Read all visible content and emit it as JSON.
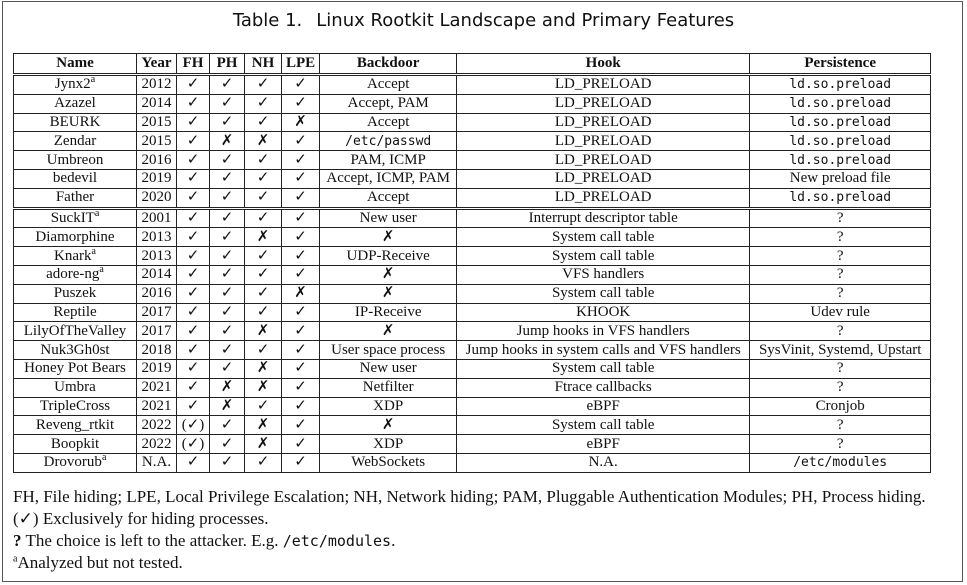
{
  "caption": {
    "number": "Table 1.",
    "title": "Linux Rootkit Landscape and Primary Features"
  },
  "headers": [
    "Name",
    "Year",
    "FH",
    "PH",
    "NH",
    "LPE",
    "Backdoor",
    "Hook",
    "Persistence"
  ],
  "group1": [
    {
      "name": "Jynx2",
      "sup": "a",
      "year": "2012",
      "fh": "✓",
      "ph": "✓",
      "nh": "✓",
      "lpe": "✓",
      "backdoor": "Accept",
      "hook": "LD_PRELOAD",
      "persistence": "ld.so.preload",
      "pmono": true
    },
    {
      "name": "Azazel",
      "sup": "",
      "year": "2014",
      "fh": "✓",
      "ph": "✓",
      "nh": "✓",
      "lpe": "✓",
      "backdoor": "Accept, PAM",
      "hook": "LD_PRELOAD",
      "persistence": "ld.so.preload",
      "pmono": true
    },
    {
      "name": "BEURK",
      "sup": "",
      "year": "2015",
      "fh": "✓",
      "ph": "✓",
      "nh": "✓",
      "lpe": "✗",
      "backdoor": "Accept",
      "hook": "LD_PRELOAD",
      "persistence": "ld.so.preload",
      "pmono": true
    },
    {
      "name": "Zendar",
      "sup": "",
      "year": "2015",
      "fh": "✓",
      "ph": "✗",
      "nh": "✗",
      "lpe": "✓",
      "backdoor": "/etc/passwd",
      "bmono": true,
      "hook": "LD_PRELOAD",
      "persistence": "ld.so.preload",
      "pmono": true
    },
    {
      "name": "Umbreon",
      "sup": "",
      "year": "2016",
      "fh": "✓",
      "ph": "✓",
      "nh": "✓",
      "lpe": "✓",
      "backdoor": "PAM, ICMP",
      "hook": "LD_PRELOAD",
      "persistence": "ld.so.preload",
      "pmono": true
    },
    {
      "name": "bedevil",
      "sup": "",
      "year": "2019",
      "fh": "✓",
      "ph": "✓",
      "nh": "✓",
      "lpe": "✓",
      "backdoor": "Accept, ICMP, PAM",
      "hook": "LD_PRELOAD",
      "persistence": "New preload file"
    },
    {
      "name": "Father",
      "sup": "",
      "year": "2020",
      "fh": "✓",
      "ph": "✓",
      "nh": "✓",
      "lpe": "✓",
      "backdoor": "Accept",
      "hook": "LD_PRELOAD",
      "persistence": "ld.so.preload",
      "pmono": true
    }
  ],
  "group2": [
    {
      "name": "SuckIT",
      "sup": "a",
      "year": "2001",
      "fh": "✓",
      "ph": "✓",
      "nh": "✓",
      "lpe": "✓",
      "backdoor": "New user",
      "hook": "Interrupt descriptor table",
      "persistence": "?"
    },
    {
      "name": "Diamorphine",
      "sup": "",
      "year": "2013",
      "fh": "✓",
      "ph": "✓",
      "nh": "✗",
      "lpe": "✓",
      "backdoor": "✗",
      "hook": "System call table",
      "persistence": "?"
    },
    {
      "name": "Knark",
      "sup": "a",
      "year": "2013",
      "fh": "✓",
      "ph": "✓",
      "nh": "✓",
      "lpe": "✓",
      "backdoor": "UDP-Receive",
      "hook": "System call table",
      "persistence": "?"
    },
    {
      "name": "adore-ng",
      "sup": "a",
      "year": "2014",
      "fh": "✓",
      "ph": "✓",
      "nh": "✓",
      "lpe": "✓",
      "backdoor": "✗",
      "hook": "VFS handlers",
      "persistence": "?"
    },
    {
      "name": "Puszek",
      "sup": "",
      "year": "2016",
      "fh": "✓",
      "ph": "✓",
      "nh": "✓",
      "lpe": "✗",
      "backdoor": "✗",
      "hook": "System call table",
      "persistence": "?"
    },
    {
      "name": "Reptile",
      "sup": "",
      "year": "2017",
      "fh": "✓",
      "ph": "✓",
      "nh": "✓",
      "lpe": "✓",
      "backdoor": "IP-Receive",
      "hook": "KHOOK",
      "persistence": "Udev rule"
    },
    {
      "name": "LilyOfTheValley",
      "sup": "",
      "year": "2017",
      "fh": "✓",
      "ph": "✓",
      "nh": "✗",
      "lpe": "✓",
      "backdoor": "✗",
      "hook": "Jump hooks in VFS handlers",
      "persistence": "?"
    },
    {
      "name": "Nuk3Gh0st",
      "sup": "",
      "year": "2018",
      "fh": "✓",
      "ph": "✓",
      "nh": "✓",
      "lpe": "✓",
      "backdoor": "User space process",
      "hook": "Jump hooks in system calls and VFS handlers",
      "persistence": "SysVinit, Systemd, Upstart"
    },
    {
      "name": "Honey Pot Bears",
      "sup": "",
      "year": "2019",
      "fh": "✓",
      "ph": "✓",
      "nh": "✗",
      "lpe": "✓",
      "backdoor": "New user",
      "hook": "System call table",
      "persistence": "?"
    },
    {
      "name": "Umbra",
      "sup": "",
      "year": "2021",
      "fh": "✓",
      "ph": "✗",
      "nh": "✗",
      "lpe": "✓",
      "backdoor": "Netfilter",
      "hook": "Ftrace callbacks",
      "persistence": "?"
    },
    {
      "name": "TripleCross",
      "sup": "",
      "year": "2021",
      "fh": "✓",
      "ph": "✗",
      "nh": "✓",
      "lpe": "✓",
      "backdoor": "XDP",
      "hook": "eBPF",
      "persistence": "Cronjob"
    },
    {
      "name": "Reveng_rtkit",
      "sup": "",
      "year": "2022",
      "fh": "(✓)",
      "ph": "✓",
      "nh": "✗",
      "lpe": "✓",
      "backdoor": "✗",
      "hook": "System call table",
      "persistence": "?"
    },
    {
      "name": "Boopkit",
      "sup": "",
      "year": "2022",
      "fh": "(✓)",
      "ph": "✓",
      "nh": "✗",
      "lpe": "✓",
      "backdoor": "XDP",
      "hook": "eBPF",
      "persistence": "?"
    },
    {
      "name": "Drovorub",
      "sup": "a",
      "year": "N.A.",
      "fh": "✓",
      "ph": "✓",
      "nh": "✓",
      "lpe": "✓",
      "backdoor": "WebSockets",
      "hook": "N.A.",
      "persistence": "/etc/modules",
      "pmono": true
    }
  ],
  "notes": {
    "line1": "FH, File hiding; LPE, Local Privilege Escalation; NH, Network hiding; PAM, Pluggable Authentication Modules; PH, Process hiding.",
    "line2_mark": "(✓)",
    "line2": " Exclusively for hiding processes.",
    "line3_mark": "?",
    "line3": " The choice is left to the attacker. E.g. ",
    "line3_code": "/etc/modules",
    "line3_end": ".",
    "line4_sup": "a",
    "line4": "Analyzed but not tested."
  }
}
